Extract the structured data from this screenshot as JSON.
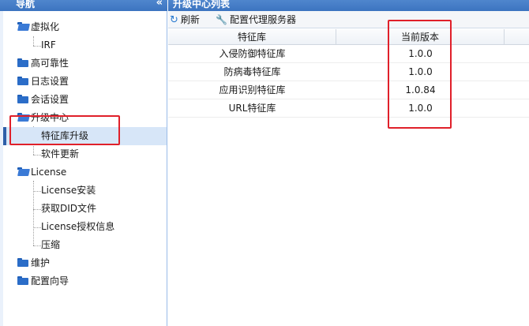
{
  "nav": {
    "title": "导航",
    "collapse_glyph": "«",
    "items": [
      {
        "label": "虚拟化"
      },
      {
        "label": "IRF"
      },
      {
        "label": "高可靠性"
      },
      {
        "label": "日志设置"
      },
      {
        "label": "会话设置"
      },
      {
        "label": "升级中心"
      },
      {
        "label": "特征库升级"
      },
      {
        "label": "软件更新"
      },
      {
        "label": "License"
      },
      {
        "label": "License安装"
      },
      {
        "label": "获取DID文件"
      },
      {
        "label": "License授权信息"
      },
      {
        "label": "压缩"
      },
      {
        "label": "维护"
      },
      {
        "label": "配置向导"
      }
    ]
  },
  "main": {
    "title": "升级中心列表",
    "toolbar": {
      "refresh_label": "刷新",
      "config_proxy_label": "配置代理服务器"
    },
    "grid": {
      "columns": [
        "特征库",
        "当前版本"
      ],
      "rows": [
        {
          "name": "入侵防御特征库",
          "version": "1.0.0"
        },
        {
          "name": "防病毒特征库",
          "version": "1.0.0"
        },
        {
          "name": "应用识别特征库",
          "version": "1.0.84"
        },
        {
          "name": "URL特征库",
          "version": "1.0.0"
        }
      ]
    }
  },
  "colors": {
    "header_blue": "#3c74c0",
    "highlight_red": "#e0202a",
    "selected_bg": "#d7e6f8"
  }
}
